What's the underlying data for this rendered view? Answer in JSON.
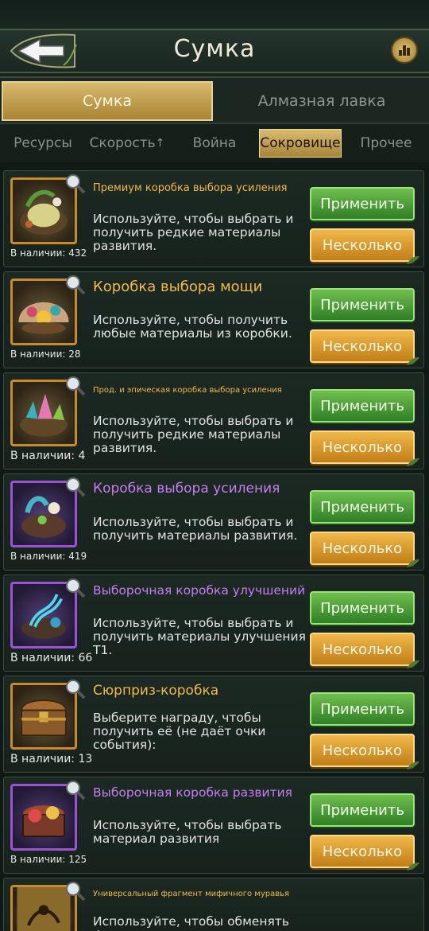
{
  "header": {
    "title": "Сумка"
  },
  "main_tabs": [
    {
      "label": "Сумка",
      "active": true
    },
    {
      "label": "Алмазная лавка",
      "active": false
    }
  ],
  "sub_tabs": [
    {
      "label": "Ресурсы",
      "active": false
    },
    {
      "label": "Скорость",
      "active": false
    },
    {
      "label": "Война",
      "active": false
    },
    {
      "label": "Сокровище",
      "active": true
    },
    {
      "label": "Прочее",
      "active": false
    }
  ],
  "items": [
    {
      "title": "Премиум коробка выбора усиления",
      "description": "Используйте, чтобы выбрать и получить редкие материалы развития.",
      "stock": "В наличии: 432",
      "rarity": "gold",
      "apply_label": "Применить",
      "multi_label": "Несколько"
    },
    {
      "title": "Коробка выбора мощи",
      "description": "Используйте, чтобы получить любые материалы из коробки.",
      "stock": "В наличии: 28",
      "rarity": "gold",
      "apply_label": "Применить",
      "multi_label": "Несколько"
    },
    {
      "title": "Прод. и эпическая коробка выбора усиления",
      "description": "Используйте, чтобы выбрать и получить редкие материалы развития.",
      "stock": "В наличии: 4",
      "rarity": "gold",
      "apply_label": "Применить",
      "multi_label": "Несколько"
    },
    {
      "title": "Коробка выбора усиления",
      "description": "Используйте, чтобы выбрать и получить материалы развития.",
      "stock": "В наличии: 419",
      "rarity": "purple",
      "apply_label": "Применить",
      "multi_label": "Несколько"
    },
    {
      "title": "Выборочная коробка улучшений",
      "description": "Используйте, чтобы выбрать и получить материалы улучшения Т1.",
      "stock": "В наличии: 66",
      "rarity": "purple",
      "apply_label": "Применить",
      "multi_label": "Несколько"
    },
    {
      "title": "Сюрприз-коробка",
      "description": "Выберите награду, чтобы получить её (не даёт очки события):",
      "stock": "В наличии: 13",
      "rarity": "gold",
      "apply_label": "Применить",
      "multi_label": "Несколько"
    },
    {
      "title": "Выборочная коробка развития",
      "description": "Используйте, чтобы выбрать материал развития",
      "stock": "В наличии: 125",
      "rarity": "purple",
      "apply_label": "Применить",
      "multi_label": "Несколько"
    },
    {
      "title": "Универсальный фрагмент мифичного муравья",
      "description": "Используйте, чтобы обменять фрагмент",
      "stock": "",
      "rarity": "gold",
      "apply_label": "",
      "multi_label": ""
    }
  ],
  "colors": {
    "gold_title": "#f3b84a",
    "purple_title": "#c67cf2",
    "apply_green": "#3f9a33",
    "multi_orange": "#e0a030"
  }
}
